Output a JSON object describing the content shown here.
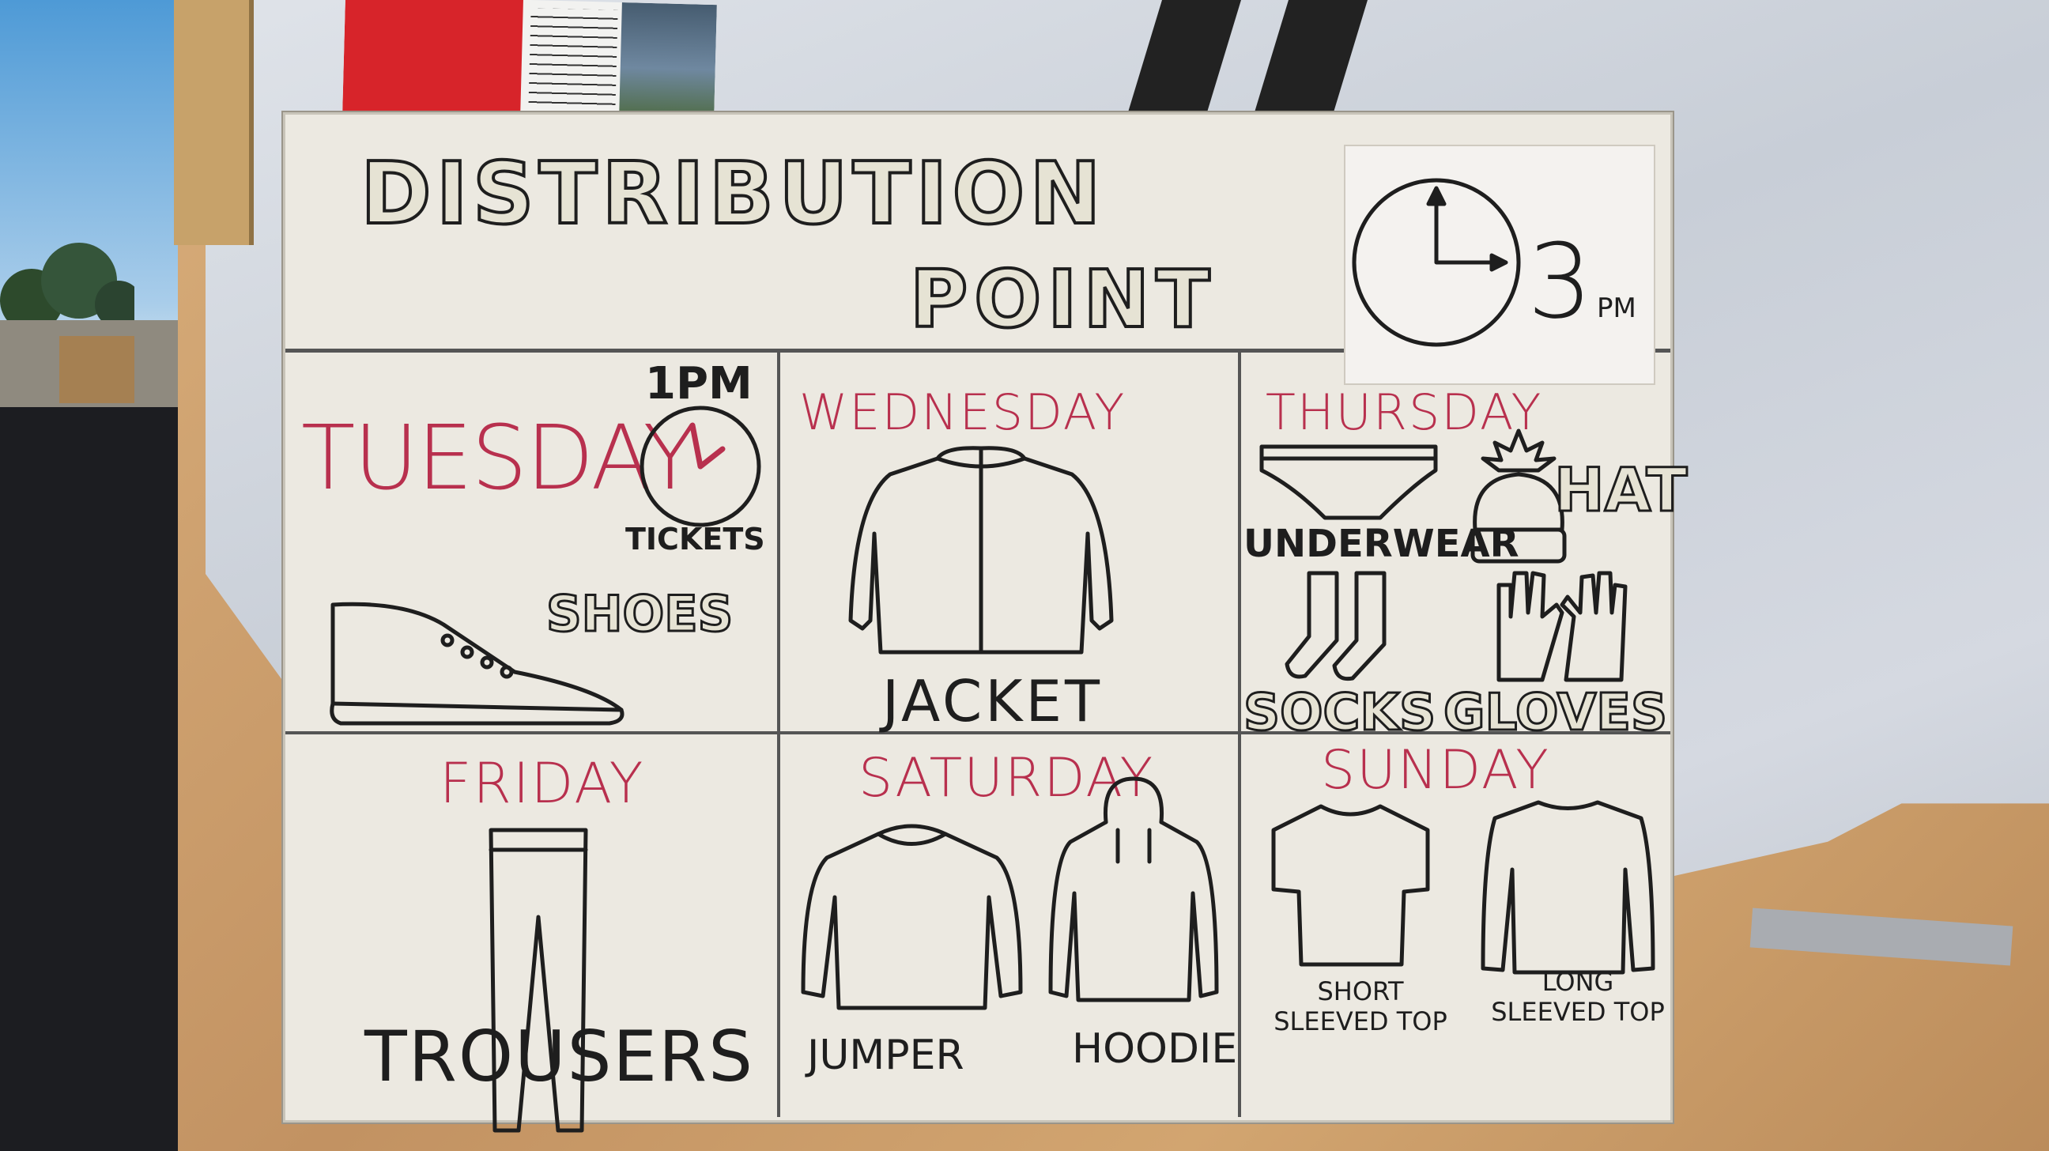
{
  "header": {
    "title_line1": "DISTRIBUTION",
    "title_line2": "POINT",
    "clock_time": "3",
    "clock_suffix": "PM"
  },
  "cells": [
    {
      "day": "TUESDAY",
      "time_label": "1PM",
      "tickets_label": "TICKETS",
      "items": [
        "SHOES"
      ]
    },
    {
      "day": "WEDNESDAY",
      "items": [
        "JACKET"
      ]
    },
    {
      "day": "THURSDAY",
      "items": [
        "UNDERWEAR",
        "HAT",
        "SOCKS",
        "GLOVES"
      ]
    },
    {
      "day": "FRIDAY",
      "items": [
        "TROUSERS"
      ]
    },
    {
      "day": "SATURDAY",
      "items": [
        "JUMPER",
        "HOODIE"
      ]
    },
    {
      "day": "SUNDAY",
      "items": [
        "SHORT SLEEVED TOP",
        "LONG SLEEVED TOP"
      ]
    }
  ],
  "colors": {
    "day_text": "#b8304e",
    "ink": "#1e1e1e",
    "board": "#ece9e1"
  },
  "icons": [
    "clock-icon",
    "small-clock-icon",
    "shoe-icon",
    "jacket-icon",
    "underwear-icon",
    "hat-icon",
    "socks-icon",
    "gloves-icon",
    "trousers-icon",
    "jumper-icon",
    "hoodie-icon",
    "tshirt-icon",
    "long-sleeve-icon"
  ]
}
